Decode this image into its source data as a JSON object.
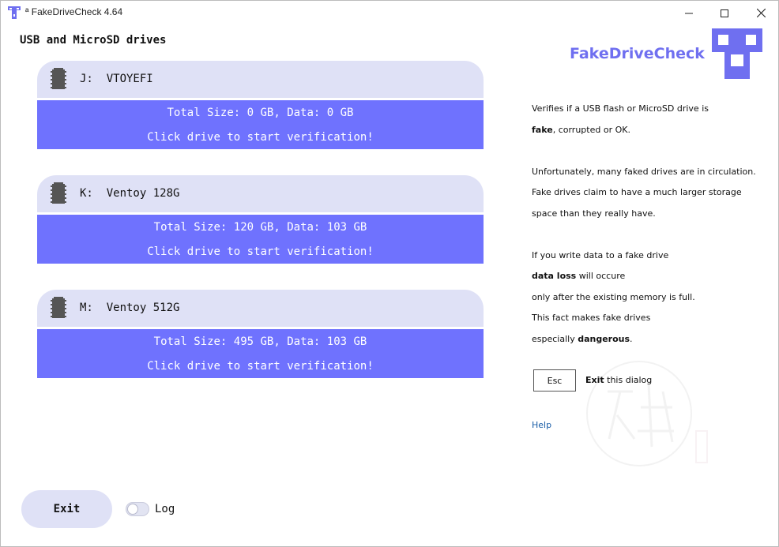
{
  "window": {
    "title": "ª FakeDriveCheck 4.64",
    "controls": [
      "minimize-icon",
      "maximize-icon",
      "close-icon"
    ]
  },
  "heading": "USB and MicroSD drives",
  "drives": [
    {
      "letter": "J:",
      "name": "VTOYEFI",
      "info": "Total Size: 0 GB, Data: 0 GB",
      "hint": "Click drive to start verification!"
    },
    {
      "letter": "K:",
      "name": "Ventoy 128G",
      "info": "Total Size: 120 GB, Data: 103 GB",
      "hint": "Click drive to start verification!"
    },
    {
      "letter": "M:",
      "name": "Ventoy 512G",
      "info": "Total Size: 495 GB, Data: 103 GB",
      "hint": "Click drive to start verification!"
    }
  ],
  "logo": {
    "text": "FakeDriveCheck",
    "color": "#6f6ff0"
  },
  "description": {
    "l1": "Verifies if a USB flash or MicroSD drive is",
    "l2_bold": "fake",
    "l2_rest": ", corrupted or OK.",
    "l3": "Unfortunately, many faked drives are in circulation.",
    "l4": "Fake drives claim to have a much larger storage",
    "l5": "space than they really have.",
    "l6": "If you write data to a fake drive",
    "l7_bold": "data loss",
    "l7_rest": " will occure",
    "l8": "only after the existing memory is full.",
    "l9": "This fact makes fake drives",
    "l10_pre": "especially ",
    "l10_bold": "dangerous",
    "l10_post": "."
  },
  "esc": {
    "key": "Esc",
    "label_bold": "Exit",
    "label_rest": " this dialog"
  },
  "help": "Help",
  "footer": {
    "exit": "Exit",
    "log": "Log",
    "log_enabled": false
  },
  "colors": {
    "accent": "#6f72fe",
    "drive_header": "#dfe1f6",
    "link": "#1c5fa8"
  }
}
